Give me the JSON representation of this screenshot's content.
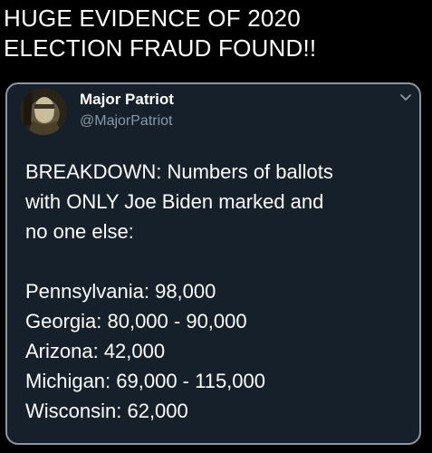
{
  "headline": {
    "lines": [
      "HUGE EVIDENCE OF 2020",
      "ELECTION FRAUD FOUND!!"
    ]
  },
  "tweet": {
    "author_name": "Major Patriot",
    "author_handle": "@MajorPatriot",
    "menu_icon": "chevron-down-icon",
    "body_lines": [
      "BREAKDOWN:  Numbers of ballots",
      "with ONLY Joe Biden marked and",
      "no one else:"
    ],
    "states": [
      "Pennsylvania:  98,000",
      "Georgia:  80,000 - 90,000",
      "Arizona:  42,000",
      "Michigan:  69,000 - 115,000",
      "Wisconsin:  62,000"
    ]
  },
  "colors": {
    "page_bg": "#000000",
    "card_bg": "#15202b",
    "card_border": "#8a96a2",
    "handle_text": "#8899a6",
    "scroll_accent": "#3a6fa8"
  }
}
